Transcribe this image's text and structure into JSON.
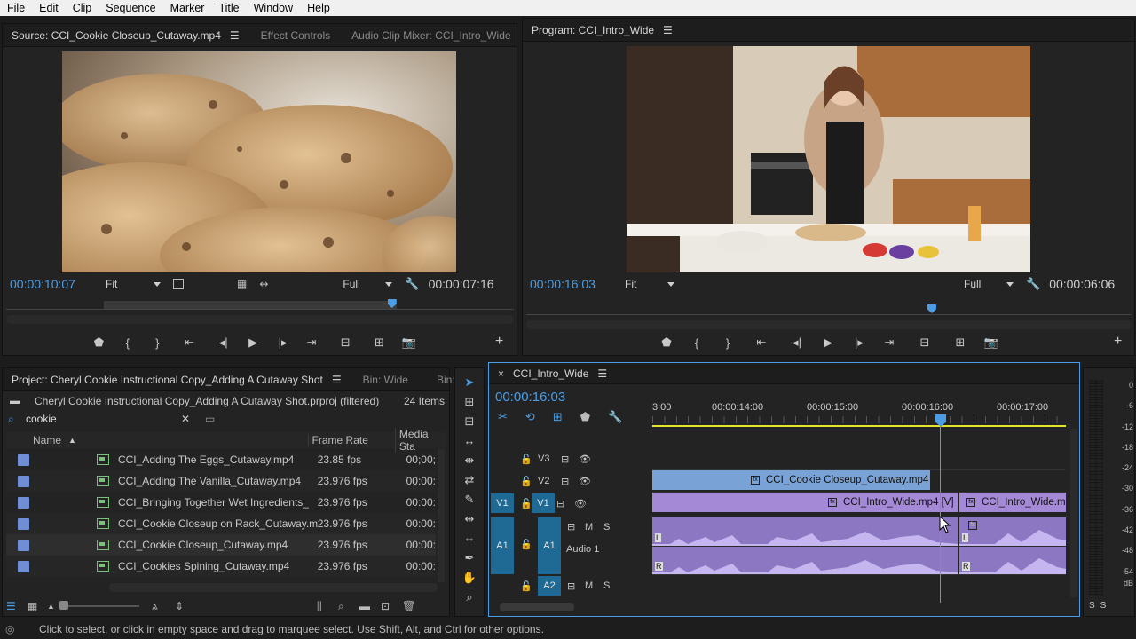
{
  "menu": [
    "File",
    "Edit",
    "Clip",
    "Sequence",
    "Marker",
    "Title",
    "Window",
    "Help"
  ],
  "source": {
    "tab_source": "Source: CCI_Cookie Closeup_Cutaway.mp4",
    "tab_effects": "Effect Controls",
    "tab_mixer": "Audio Clip Mixer: CCI_Intro_Wide",
    "timecode": "00:00:10:07",
    "zoom": "Fit",
    "resolution": "Full",
    "duration": "00:00:07:16",
    "playhead_fraction": 0.76
  },
  "program": {
    "tab": "Program: CCI_Intro_Wide",
    "timecode": "00:00:16:03",
    "zoom": "Fit",
    "resolution": "Full",
    "duration": "00:00:06:06",
    "playhead_fraction": 0.67
  },
  "project": {
    "tab_project": "Project: Cheryl Cookie Instructional Copy_Adding A Cutaway Shot",
    "tab_bin": "Bin: Wide",
    "tab_bin2": "Bin:",
    "file": "Cheryl Cookie Instructional Copy_Adding A Cutaway Shot.prproj (filtered)",
    "item_count": "24 Items",
    "search": "cookie",
    "col_name": "Name",
    "col_framerate": "Frame Rate",
    "col_mediastart": "Media Sta",
    "rows": [
      {
        "name": "CCI_Adding The Eggs_Cutaway.mp4",
        "fps": "23.85 fps",
        "start": "00;00;"
      },
      {
        "name": "CCI_Adding The Vanilla_Cutaway.mp4",
        "fps": "23.976 fps",
        "start": "00:00:"
      },
      {
        "name": "CCI_Bringing Together Wet Ingredients_",
        "fps": "23.976 fps",
        "start": "00:00:"
      },
      {
        "name": "CCI_Cookie Closeup on Rack_Cutaway.m",
        "fps": "23.976 fps",
        "start": "00:00:"
      },
      {
        "name": "CCI_Cookie Closeup_Cutaway.mp4",
        "fps": "23.976 fps",
        "start": "00:00:"
      },
      {
        "name": "CCI_Cookies Spining_Cutaway.mp4",
        "fps": "23.976 fps",
        "start": "00:00:"
      }
    ]
  },
  "timeline": {
    "tab": "CCI_Intro_Wide",
    "close": "×",
    "timecode": "00:00:16:03",
    "ruler_labels": [
      "3:00",
      "00:00:14:00",
      "00:00:15:00",
      "00:00:16:00",
      "00:00:17:00"
    ],
    "tracks": {
      "v3": "V3",
      "v2": "V2",
      "v1": "V1",
      "a1": "A1",
      "a2": "A2",
      "audio1": "Audio 1",
      "m": "M",
      "s": "S"
    },
    "clips": {
      "v2": "CCI_Cookie Closeup_Cutaway.mp4",
      "v1a": "CCI_Intro_Wide.mp4 [V]",
      "v1b": "CCI_Intro_Wide.m"
    },
    "audio_l": "L",
    "audio_r": "R"
  },
  "meter": {
    "labels": [
      "0",
      "-6",
      "-12",
      "-18",
      "-24",
      "-30",
      "-36",
      "-42",
      "-48",
      "-54",
      "dB"
    ],
    "solo": [
      "S",
      "S"
    ]
  },
  "status": "Click to select, or click in empty space and drag to marquee select. Use Shift, Alt, and Ctrl for other options.",
  "colors": {
    "accent_blue": "#4b9de6",
    "clip_video": "#79a3d6",
    "clip_av": "#a489d6",
    "track_target": "#1e6a94"
  }
}
